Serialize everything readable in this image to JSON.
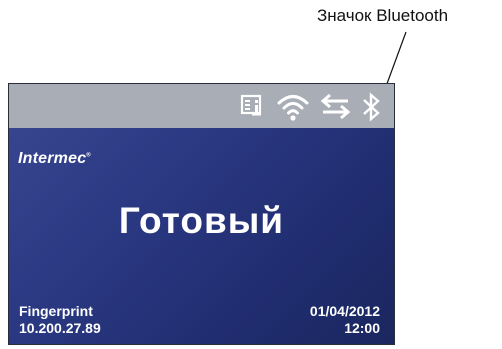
{
  "callout": {
    "label": "Значок Bluetooth"
  },
  "screen": {
    "status_bar": {
      "icons": [
        "printer-info-icon",
        "wifi-icon",
        "transfer-arrows-icon",
        "bluetooth-icon"
      ]
    },
    "logo": {
      "text": "Intermec",
      "mark": "®"
    },
    "status": "Готовый",
    "app_name": "Fingerprint",
    "ip_address": "10.200.27.89",
    "date": "01/04/2012",
    "time": "12:00"
  },
  "colors": {
    "screen_background": "#2c3a85",
    "status_bar": "#a8adb6",
    "text": "#ffffff"
  }
}
